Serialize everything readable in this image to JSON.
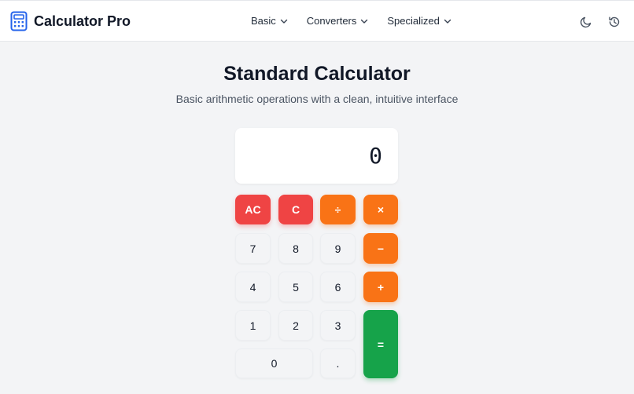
{
  "brand": {
    "name": "Calculator Pro",
    "icon": "calculator-icon",
    "accent": "#2563eb"
  },
  "nav": {
    "items": [
      {
        "label": "Basic"
      },
      {
        "label": "Converters"
      },
      {
        "label": "Specialized"
      }
    ],
    "actions": [
      "moon-icon",
      "history-icon"
    ]
  },
  "page": {
    "title": "Standard Calculator",
    "subtitle": "Basic arithmetic operations with a clean, intuitive interface"
  },
  "display": {
    "value": "0"
  },
  "keys": {
    "ac": "AC",
    "c": "C",
    "divide": "÷",
    "multiply": "×",
    "seven": "7",
    "eight": "8",
    "nine": "9",
    "minus": "−",
    "four": "4",
    "five": "5",
    "six": "6",
    "plus": "+",
    "one": "1",
    "two": "2",
    "three": "3",
    "equals": "=",
    "zero": "0",
    "decimal": "."
  },
  "colors": {
    "clear": "#ef4444",
    "operator": "#f97316",
    "equals": "#16a34a",
    "number": "#f3f4f6"
  }
}
